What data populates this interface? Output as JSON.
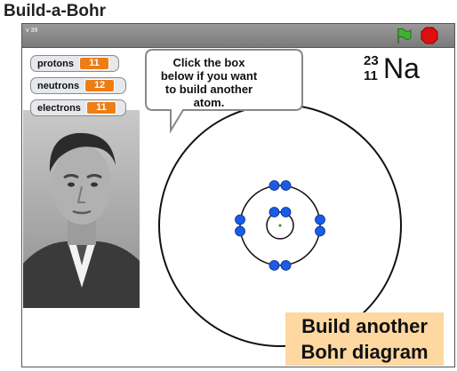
{
  "page": {
    "title": "Build-a-Bohr"
  },
  "player": {
    "version": "v 39"
  },
  "monitors": [
    {
      "label": "protons",
      "value": "11"
    },
    {
      "label": "neutrons",
      "value": "12"
    },
    {
      "label": "electrons",
      "value": "11"
    }
  ],
  "speech": {
    "lines": [
      "Click the box",
      "below if you want",
      "to build another",
      "atom."
    ]
  },
  "element": {
    "mass_number": "23",
    "atomic_number": "11",
    "symbol": "Na"
  },
  "button": {
    "line1": "Build another",
    "line2": "Bohr diagram"
  },
  "colors": {
    "electron": "#1a5ce6",
    "button_bg": "#fdd8a0",
    "monitor_value": "#ee7d16"
  },
  "icons": {
    "flag": "green-flag-icon",
    "stop": "stop-sign-icon"
  }
}
